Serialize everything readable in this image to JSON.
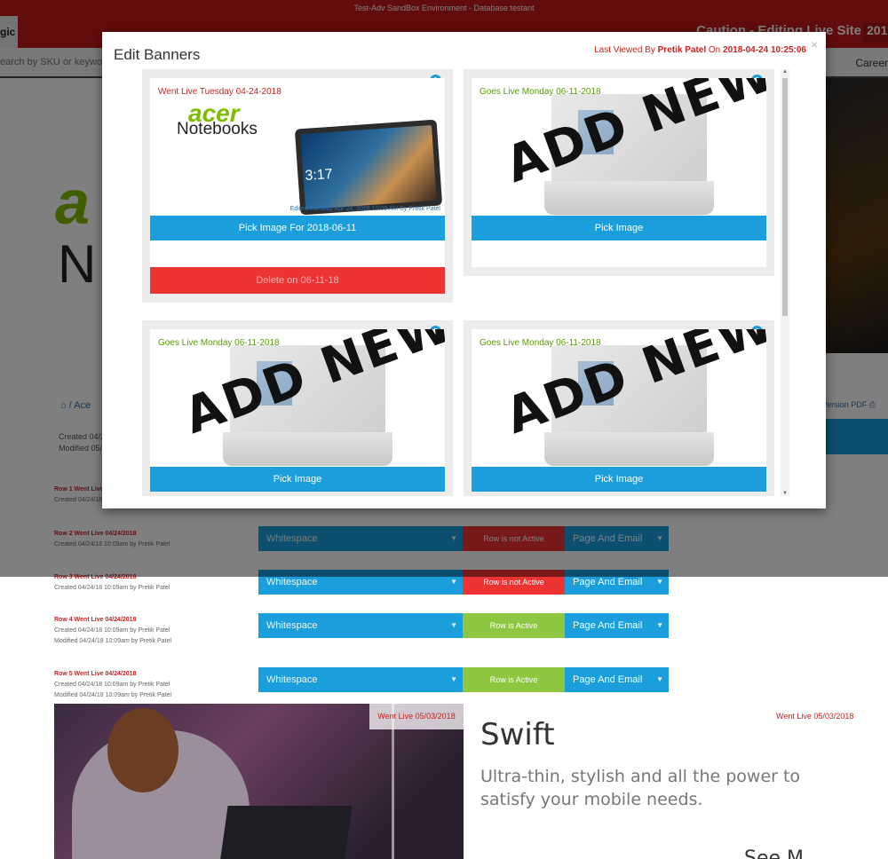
{
  "env": {
    "title": "Test-Adv SandBox Environment - Database:testant"
  },
  "admin": {
    "brand": "gic",
    "caution": "Caution - Editing Live Site",
    "year": "201"
  },
  "search": {
    "placeholder": "earch by SKU or keyword",
    "career": "Career"
  },
  "bg": {
    "hero_a": "a",
    "hero_n": "N",
    "breadcrumb": "⌂ /  Ace",
    "pdf": "Version PDF ⎙",
    "created_line1": "Created 04/2",
    "created_line2": "Modified 05/2"
  },
  "rows": [
    {
      "title": "Row 1 Went Live",
      "created": "Created 04/24/18",
      "modified": ""
    },
    {
      "title": "Row 2 Went Live 04/24/2018",
      "created": "Created 04/24/18 10:09am by Pretik Patel",
      "modified": "",
      "select": "Whitespace",
      "status": "Row is not Active",
      "status_type": "inactive",
      "mode": "Page And Email"
    },
    {
      "title": "Row 3 Went Live 04/24/2018",
      "created": "Created 04/24/18 10:09am by Pretik Patel",
      "modified": "",
      "select": "Whitespace",
      "status": "Row is not Active",
      "status_type": "inactive",
      "mode": "Page And Email"
    },
    {
      "title": "Row 4 Went Live 04/24/2018",
      "created": "Created   04/24/18 10:09am by Pretik Patel",
      "modified": "Modified 04/24/18 10:09am by Pretik Patel",
      "select": "Whitespace",
      "status": "Row is Active",
      "status_type": "active",
      "mode": "Page And Email"
    },
    {
      "title": "Row 5 Went Live 04/24/2018",
      "created": "Created   04/24/18 10:09am by Pretik Patel",
      "modified": "Modified 04/24/18 10:09am by Pretik Patel",
      "select": "Whitespace",
      "status": "Row is Active",
      "status_type": "active",
      "mode": "Page And Email"
    }
  ],
  "promo": {
    "badge": "Went Live 05/03/2018",
    "right_live": "Went Live 05/03/2018",
    "title": "Swift",
    "desc": "Ultra-thin, stylish and all the power to satisfy your mobile needs.",
    "more": "See M"
  },
  "modal": {
    "title": "Edit Banners",
    "last_viewed_prefix": "Last Viewed By ",
    "last_viewed_user": "Pretik Patel",
    "last_viewed_mid": " On ",
    "last_viewed_date": "2018-04-24 10:25:06",
    "close": "×",
    "cards": [
      {
        "num": "1",
        "live": "Went Live Tuesday 04-24-2018",
        "live_type": "went",
        "logo": "acer",
        "logo_sub": "Notebooks",
        "clock": "3:17",
        "edited": "Edited Tuesday Apr 24, 2018 10:09 AM By Pretik Patel",
        "pick": "Pick Image For 2018-06-11",
        "delete": "Delete on 06-11-18"
      },
      {
        "num": "2",
        "live": "Goes Live Monday 06-11-2018",
        "live_type": "goes",
        "stamp": "ADD NEW",
        "pick": "Pick Image"
      },
      {
        "num": "3",
        "live": "Goes Live Monday 06-11-2018",
        "live_type": "goes",
        "stamp": "ADD NEW",
        "pick": "Pick Image"
      },
      {
        "num": "4",
        "live": "Goes Live Monday 06-11-2018",
        "live_type": "goes",
        "stamp": "ADD NEW",
        "pick": "Pick Image"
      }
    ]
  },
  "colors": {
    "accent": "#1a9fdc",
    "danger": "#ee3333",
    "success": "#8dc63f",
    "admin_red": "#c41a1a",
    "brand_green": "#80bc00"
  }
}
